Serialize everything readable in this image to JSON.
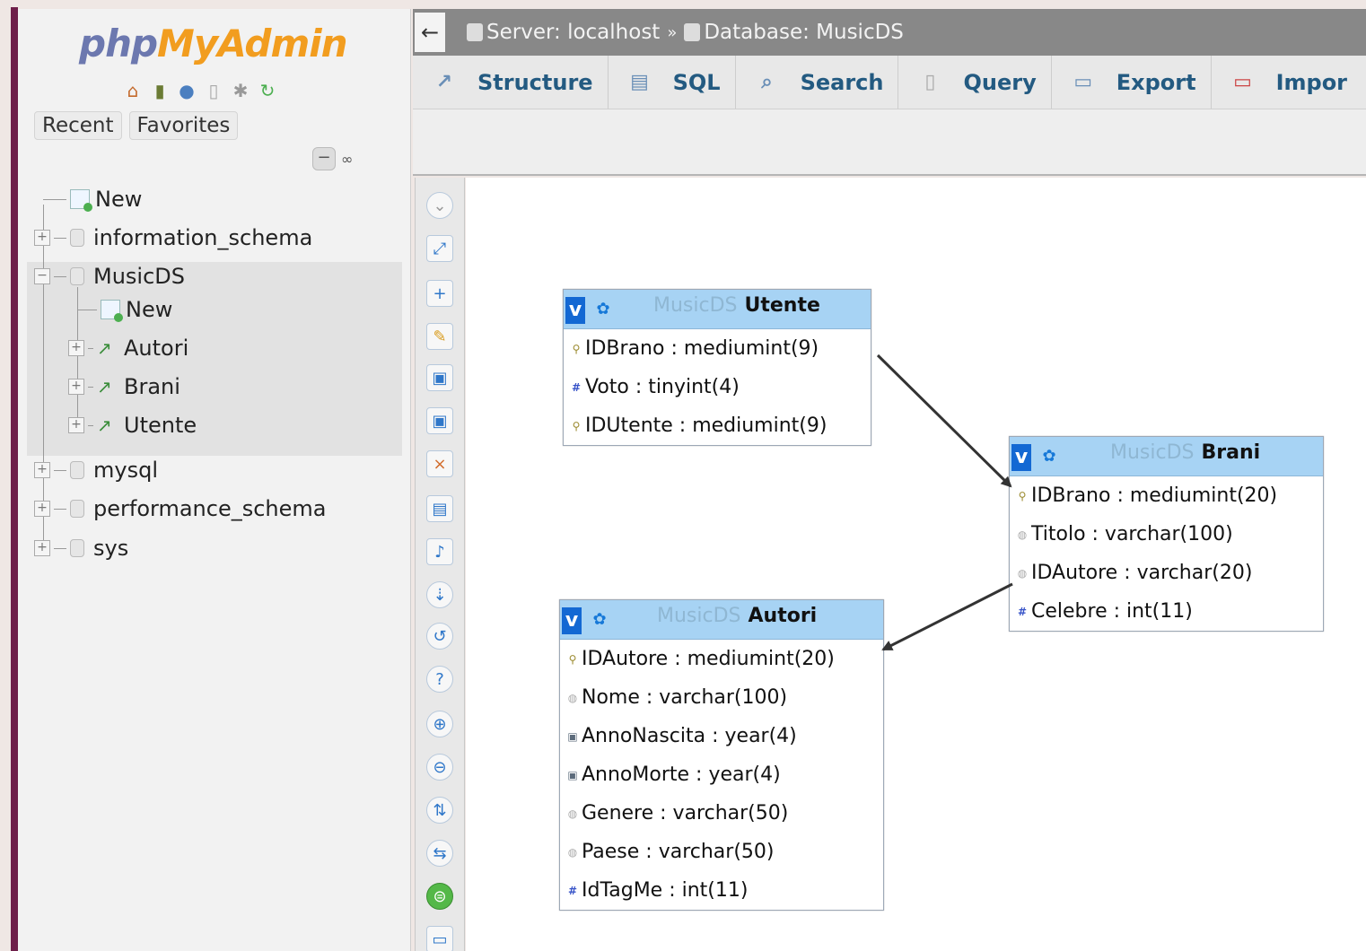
{
  "nav": {
    "logo_php": "php",
    "logo_rest": "MyAdmin",
    "icons": [
      "home-icon",
      "server-icon",
      "info-icon",
      "docs-icon",
      "settings-icon",
      "reload-icon"
    ],
    "tabs": [
      "Recent",
      "Favorites"
    ],
    "collapse_label": "−",
    "link_label": "∞",
    "tree": {
      "new": "New",
      "databases": [
        {
          "name": "information_schema"
        },
        {
          "name": "MusicDS",
          "expanded": true,
          "children": [
            {
              "name": "New"
            },
            {
              "name": "Autori"
            },
            {
              "name": "Brani"
            },
            {
              "name": "Utente"
            }
          ]
        },
        {
          "name": "mysql"
        },
        {
          "name": "performance_schema"
        },
        {
          "name": "sys"
        }
      ]
    }
  },
  "breadcrumb": {
    "back": "←",
    "server": "Server: localhost",
    "separator": "»",
    "database": "Database: MusicDS"
  },
  "menu": {
    "tabs": [
      {
        "label": "Structure",
        "icon": "structure-icon"
      },
      {
        "label": "SQL",
        "icon": "sql-icon"
      },
      {
        "label": "Search",
        "icon": "search-icon"
      },
      {
        "label": "Query",
        "icon": "query-icon"
      },
      {
        "label": "Export",
        "icon": "export-icon"
      },
      {
        "label": "Impor",
        "icon": "import-icon"
      }
    ]
  },
  "designer": {
    "tables": [
      {
        "db": "MusicDS",
        "name": "Utente",
        "fields": [
          {
            "icon": "key",
            "text": "IDBrano : mediumint(9)"
          },
          {
            "icon": "num",
            "text": "Voto : tinyint(4)"
          },
          {
            "icon": "key",
            "text": "IDUtente : mediumint(9)"
          }
        ]
      },
      {
        "db": "MusicDS",
        "name": "Brani",
        "fields": [
          {
            "icon": "key",
            "text": "IDBrano : mediumint(20)"
          },
          {
            "icon": "str",
            "text": "Titolo : varchar(100)"
          },
          {
            "icon": "str",
            "text": "IDAutore : varchar(20)"
          },
          {
            "icon": "num",
            "text": "Celebre : int(11)"
          }
        ]
      },
      {
        "db": "MusicDS",
        "name": "Autori",
        "fields": [
          {
            "icon": "key",
            "text": "IDAutore : mediumint(20)"
          },
          {
            "icon": "str",
            "text": "Nome : varchar(100)"
          },
          {
            "icon": "yr",
            "text": "AnnoNascita : year(4)"
          },
          {
            "icon": "yr",
            "text": "AnnoMorte : year(4)"
          },
          {
            "icon": "str",
            "text": "Genere : varchar(50)"
          },
          {
            "icon": "str",
            "text": "Paese : varchar(50)"
          },
          {
            "icon": "num",
            "text": "IdTagMe : int(11)"
          }
        ]
      }
    ],
    "table_toggle": "v",
    "tools": [
      "toggle-menu-icon",
      "fullscreen-icon",
      "new-page-icon",
      "edit-page-icon",
      "save-icon",
      "save-as-icon",
      "delete-page-icon",
      "pdf-schema-icon",
      "relation-line-icon",
      "arrange-icon",
      "angular-links-icon",
      "help-icon",
      "grid-icon",
      "small-big-icon",
      "toggle-all-icon",
      "toggle-relations-icon",
      "active-tool-icon",
      "export-schema-icon"
    ]
  }
}
